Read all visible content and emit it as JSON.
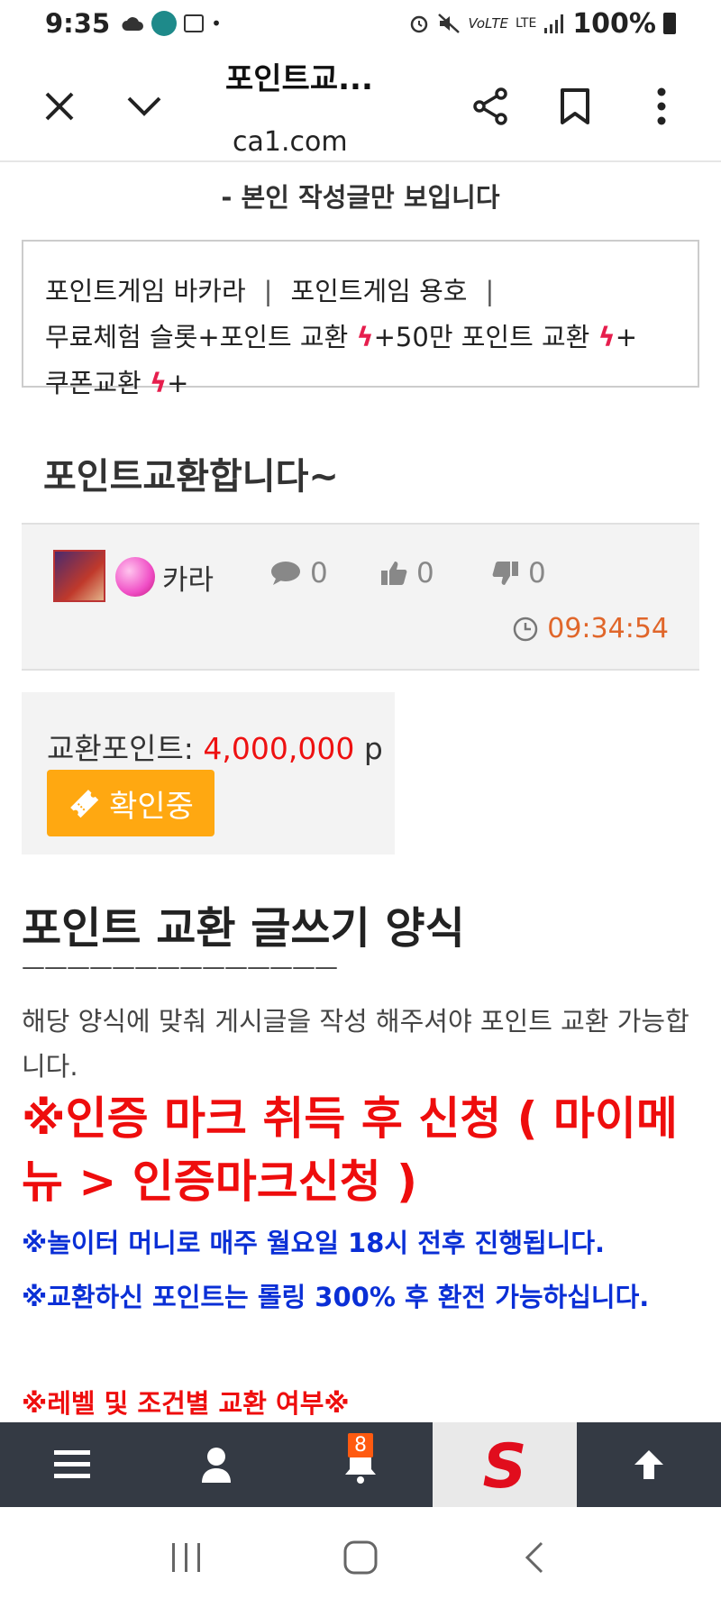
{
  "status_bar": {
    "time": "9:35",
    "battery": "100%",
    "network": "LTE"
  },
  "browser": {
    "title": "포인트교...",
    "url": "ca1.com"
  },
  "notice": "- 본인 작성글만 보입니다",
  "categories": {
    "item1": "포인트게임 바카라",
    "item2": "포인트게임 용호",
    "item3": "무료체험 슬롯",
    "item4": "포인트 교환",
    "item5": "50만 포인트 교환",
    "item6": "쿠폰교환",
    "plus": "+",
    "bolt": "ϟ"
  },
  "post": {
    "title": "포인트교환합니다~",
    "author": "카라",
    "comments": "0",
    "likes": "0",
    "dislikes": "0",
    "time": "09:34:54"
  },
  "exchange": {
    "label": "교환포인트:",
    "value": "4,000,000",
    "unit": "p",
    "status": "확인중"
  },
  "body": {
    "heading": "포인트 교환 글쓰기 양식",
    "divider": "——————————————",
    "paragraph": "해당 양식에 맞춰 게시글을 작성 해주셔야 포인트 교환 가능합니다.",
    "red_notice": "※인증 마크 취득 후 신청 ( 마이메뉴 > 인증마크신청 )",
    "blue1": "※놀이터 머니로 매주 월요일 18시 전후 진행됩니다.",
    "blue2": "※교환하신 포인트는 롤링 300% 후 환전 가능하십니다.",
    "red_small": "※레벨 및 조건별 교환 여부※"
  },
  "bottom_nav": {
    "badge": "8",
    "logo_text": "S"
  },
  "colors": {
    "accent_orange": "#ffa811",
    "time_orange": "#e0662a",
    "red": "#ee0d0d",
    "blue": "#0a2fd6",
    "nav_bg": "#343a44"
  }
}
